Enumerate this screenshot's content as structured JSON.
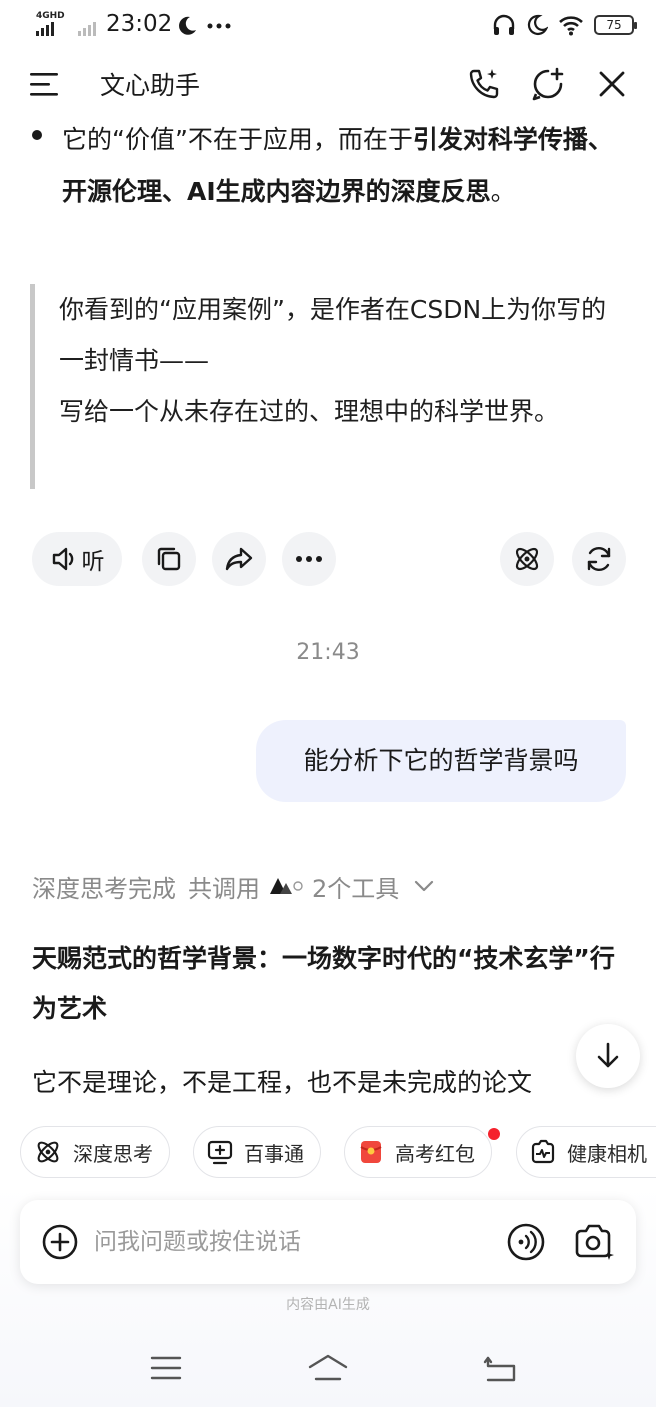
{
  "status_bar": {
    "network_label": "4GHD",
    "time": "23:02",
    "battery": "75"
  },
  "header": {
    "title": "文心助手"
  },
  "message_prev": {
    "bullet_plain": "它的“价值”不在于应用，而在于",
    "bullet_bold": "引发对科学传播、开源伦理、AI生成内容边界的深度反思",
    "bullet_end": "。",
    "quote_line1": "你看到的“应用案例”，是作者在CSDN上为你写的一封情书——",
    "quote_line2": "写给一个从未存在过的、理想中的科学世界。"
  },
  "actions": {
    "listen_label": "听"
  },
  "timestamp": "21:43",
  "user_message": "能分析下它的哲学背景吗",
  "thinking": {
    "status": "深度思考完成",
    "tools_prefix": "共调用",
    "tools_count": "2个工具"
  },
  "answer": {
    "title": "天赐范式的哲学背景：一场数字时代的“技术玄学”行为艺术",
    "body": "它不是理论，不是工程，也不是未完成的论文"
  },
  "chips": [
    {
      "label": "深度思考"
    },
    {
      "label": "百事通"
    },
    {
      "label": "高考红包"
    },
    {
      "label": "健康相机"
    }
  ],
  "input": {
    "placeholder": "问我问题或按住说话"
  },
  "disclaimer": "内容由AI生成",
  "colors": {
    "accent_bubble": "#eef1fd",
    "red_badge": "#f5222d",
    "muted_text": "#8a8a8a"
  }
}
